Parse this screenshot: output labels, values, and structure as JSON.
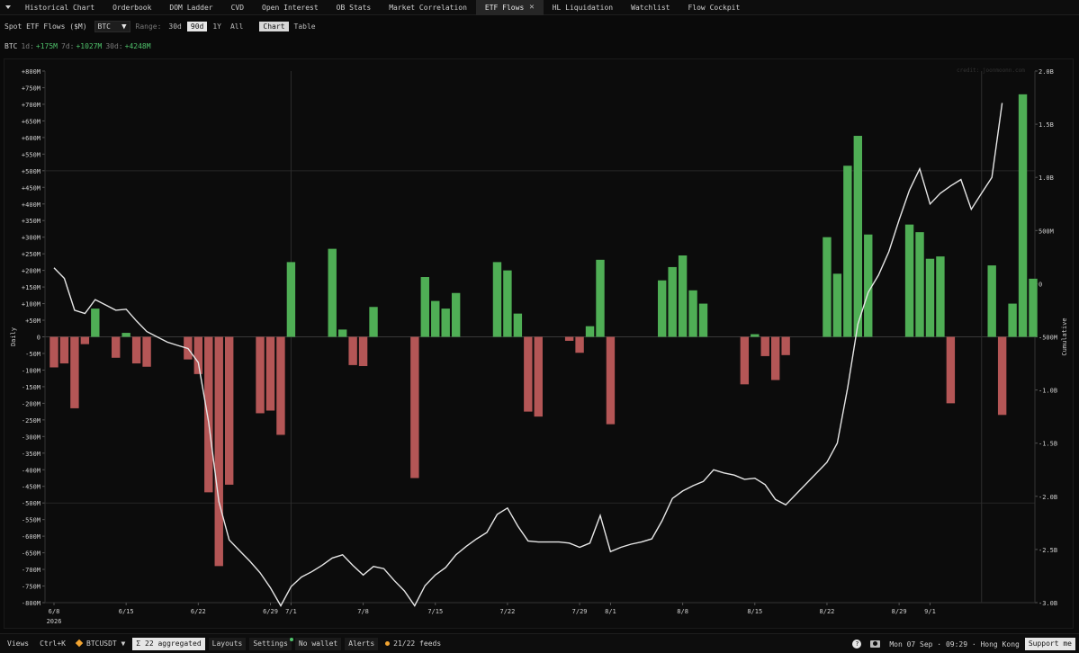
{
  "tabs": [
    {
      "label": "Historical Chart"
    },
    {
      "label": "Orderbook"
    },
    {
      "label": "DOM Ladder"
    },
    {
      "label": "CVD"
    },
    {
      "label": "Open Interest"
    },
    {
      "label": "OB Stats"
    },
    {
      "label": "Market Correlation"
    },
    {
      "label": "ETF Flows",
      "active": true
    },
    {
      "label": "HL Liquidation"
    },
    {
      "label": "Watchlist"
    },
    {
      "label": "Flow Cockpit"
    }
  ],
  "controls": {
    "title": "Spot ETF Flows ($M)",
    "asset": "BTC",
    "range_label": "Range:",
    "ranges": [
      "30d",
      "90d",
      "1Y",
      "All"
    ],
    "range_selected": "90d",
    "views": [
      "Chart",
      "Table"
    ],
    "view_selected": "Chart"
  },
  "summary": {
    "asset": "BTC",
    "d1_label": "1d:",
    "d1_value": "+175M",
    "d7_label": "7d:",
    "d7_value": "+1027M",
    "d30_label": "30d:",
    "d30_value": "+4248M"
  },
  "watermark": "credit: joonmoonn.com",
  "colors": {
    "positive": "#4fae55",
    "negative": "#b45656",
    "line": "#e6e6e6"
  },
  "chart_data": {
    "type": "bar",
    "title": "Spot ETF Flows ($M)",
    "ylabel": "Daily",
    "y2label": "Cumulative",
    "ylim": [
      -800,
      800
    ],
    "y2lim": [
      -3.0,
      2.0
    ],
    "y_ticks": [
      "+800M",
      "+750M",
      "+700M",
      "+650M",
      "+600M",
      "+550M",
      "+500M",
      "+450M",
      "+400M",
      "+350M",
      "+300M",
      "+250M",
      "+200M",
      "+150M",
      "+100M",
      "+50M",
      "0",
      "-50M",
      "-100M",
      "-150M",
      "-200M",
      "-250M",
      "-300M",
      "-350M",
      "-400M",
      "-450M",
      "-500M",
      "-550M",
      "-600M",
      "-650M",
      "-700M",
      "-750M",
      "-800M"
    ],
    "y2_ticks": [
      "2.0B",
      "1.5B",
      "1.0B",
      "500M",
      "0",
      "-500M",
      "-1.0B",
      "-1.5B",
      "-2.0B",
      "-2.5B",
      "-3.0B"
    ],
    "x_ticks": [
      "6/8",
      "6/15",
      "6/22",
      "6/29",
      "7/1",
      "7/8",
      "7/15",
      "7/22",
      "7/29",
      "8/1",
      "8/8",
      "8/15",
      "8/22",
      "8/29",
      "9/1"
    ],
    "x_year": "2026",
    "series": [
      {
        "type": "bar",
        "values": [
          -92,
          -80,
          -215,
          -22,
          85,
          0,
          -63,
          12,
          -80,
          -90,
          0,
          0,
          0,
          -68,
          -112,
          -468,
          -690,
          -445,
          0,
          0,
          -230,
          -222,
          -295,
          225,
          0,
          0,
          0,
          265,
          22,
          -85,
          -88,
          90,
          0,
          0,
          0,
          -425,
          180,
          108,
          85,
          132,
          0,
          0,
          0,
          225,
          200,
          70,
          -225,
          -240,
          0,
          0,
          -12,
          -48,
          32,
          232,
          -263,
          0,
          0,
          0,
          0,
          170,
          210,
          245,
          140,
          100,
          0,
          0,
          0,
          -143,
          8,
          -58,
          -130,
          -55,
          0,
          0,
          0,
          300,
          190,
          515,
          605,
          308,
          0,
          0,
          0,
          338,
          315,
          235,
          242,
          -200,
          0,
          0,
          0,
          215,
          -235,
          100,
          730,
          175
        ]
      },
      {
        "type": "line",
        "name": "Cumulative",
        "values": [
          0.15,
          0.05,
          -0.25,
          -0.28,
          -0.15,
          -0.2,
          -0.25,
          -0.24,
          -0.35,
          -0.45,
          -0.5,
          -0.55,
          -0.58,
          -0.61,
          -0.74,
          -1.3,
          -2.05,
          -2.41,
          -2.51,
          -2.61,
          -2.72,
          -2.86,
          -3.03,
          -2.85,
          -2.76,
          -2.71,
          -2.65,
          -2.58,
          -2.55,
          -2.65,
          -2.74,
          -2.66,
          -2.68,
          -2.79,
          -2.89,
          -3.03,
          -2.84,
          -2.74,
          -2.67,
          -2.55,
          -2.47,
          -2.4,
          -2.34,
          -2.17,
          -2.11,
          -2.28,
          -2.42,
          -2.43,
          -2.43,
          -2.43,
          -2.44,
          -2.48,
          -2.44,
          -2.18,
          -2.52,
          -2.48,
          -2.45,
          -2.43,
          -2.4,
          -2.23,
          -2.02,
          -1.95,
          -1.9,
          -1.86,
          -1.75,
          -1.78,
          -1.8,
          -1.84,
          -1.83,
          -1.89,
          -2.03,
          -2.08,
          -1.98,
          -1.88,
          -1.78,
          -1.68,
          -1.5,
          -0.98,
          -0.38,
          -0.08,
          0.08,
          0.3,
          0.6,
          0.88,
          1.08,
          0.75,
          0.85,
          0.92,
          0.98,
          0.7,
          0.85,
          1.0,
          1.7
        ]
      }
    ]
  },
  "status": {
    "views": "Views",
    "shortcut": "Ctrl+K",
    "symbol": "BTCUSDT",
    "aggregated": "22 aggregated",
    "layouts": "Layouts",
    "settings": "Settings",
    "wallet": "No wallet",
    "alerts": "Alerts",
    "feeds": "21/22 feeds",
    "datetime": "Mon 07 Sep · 09:29 · Hong Kong",
    "support": "Support me"
  }
}
